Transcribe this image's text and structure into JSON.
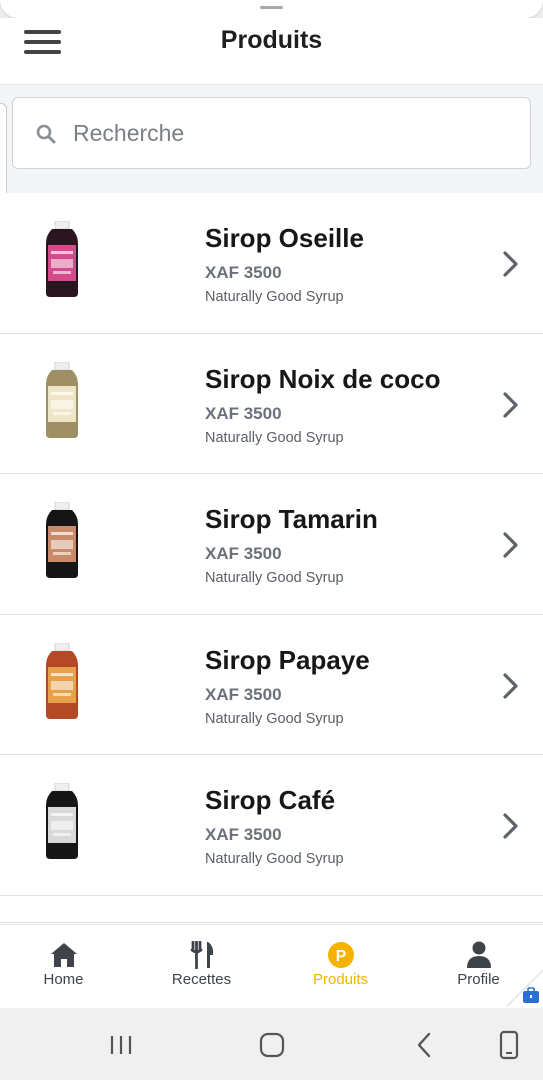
{
  "header": {
    "title": "Produits"
  },
  "search": {
    "placeholder": "Recherche"
  },
  "products": [
    {
      "name": "Sirop Oseille",
      "price": "XAF 3500",
      "description": "Naturally Good Syrup",
      "label_color": "#d44a8a",
      "liquid_color": "#2a1520"
    },
    {
      "name": "Sirop Noix de coco",
      "price": "XAF 3500",
      "description": "Naturally Good Syrup",
      "label_color": "#efe6c8",
      "liquid_color": "#9e9064"
    },
    {
      "name": "Sirop Tamarin",
      "price": "XAF 3500",
      "description": "Naturally Good Syrup",
      "label_color": "#c98a6a",
      "liquid_color": "#151515"
    },
    {
      "name": "Sirop Papaye",
      "price": "XAF 3500",
      "description": "Naturally Good Syrup",
      "label_color": "#e8a04a",
      "liquid_color": "#b34a25"
    },
    {
      "name": "Sirop Café",
      "price": "XAF 3500",
      "description": "Naturally Good Syrup",
      "label_color": "#d9d9d9",
      "liquid_color": "#161616"
    }
  ],
  "tabs": [
    {
      "label": "Home",
      "icon": "home-icon",
      "active": false
    },
    {
      "label": "Recettes",
      "icon": "fork-knife-icon",
      "active": false
    },
    {
      "label": "Produits",
      "icon": "produits-badge-icon",
      "active": true
    },
    {
      "label": "Profile",
      "icon": "user-icon",
      "active": false
    }
  ],
  "produits_badge_letter": "P",
  "colors": {
    "accent": "#f5b300",
    "text_dark": "#171717",
    "text_muted": "#6b717a"
  }
}
